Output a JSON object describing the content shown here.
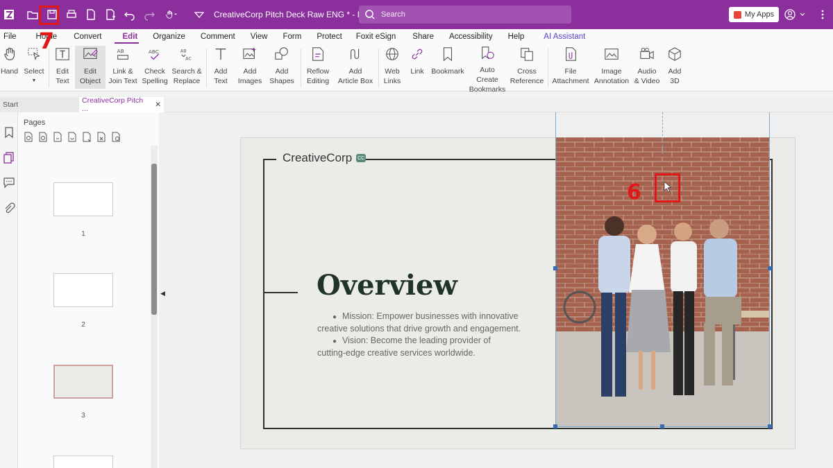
{
  "titlebar": {
    "doc_title": "CreativeCorp Pitch Deck Raw ENG * - Foxit PDF...",
    "search_placeholder": "Search",
    "my_apps": "My Apps"
  },
  "menu": [
    "File",
    "Home",
    "Convert",
    "Edit",
    "Organize",
    "Comment",
    "View",
    "Form",
    "Protect",
    "Foxit eSign",
    "Share",
    "Accessibility",
    "Help",
    "AI Assistant"
  ],
  "ribbon": {
    "hand": "Hand",
    "select": "Select",
    "edit_text": [
      "Edit",
      "Text"
    ],
    "edit_object": [
      "Edit",
      "Object"
    ],
    "link_join": [
      "Link &",
      "Join Text"
    ],
    "check_spelling": [
      "Check",
      "Spelling"
    ],
    "search_replace": [
      "Search &",
      "Replace"
    ],
    "add_text": [
      "Add",
      "Text"
    ],
    "add_images": [
      "Add",
      "Images"
    ],
    "add_shapes": [
      "Add",
      "Shapes"
    ],
    "reflow_editing": [
      "Reflow",
      "Editing"
    ],
    "add_article_box": [
      "Add",
      "Article Box"
    ],
    "web_links": [
      "Web",
      "Links"
    ],
    "link": "Link",
    "bookmark": "Bookmark",
    "auto_create_bookmarks": [
      "Auto Create",
      "Bookmarks"
    ],
    "cross_reference": [
      "Cross",
      "Reference"
    ],
    "file_attachment": [
      "File",
      "Attachment"
    ],
    "image_annotation": [
      "Image",
      "Annotation"
    ],
    "audio_video": [
      "Audio",
      "& Video"
    ],
    "add_3d": [
      "Add",
      "3D"
    ]
  },
  "tabs": {
    "start": "Start",
    "doc": "CreativeCorp Pitch ..."
  },
  "pages_panel": {
    "title": "Pages",
    "thumbnails": [
      "1",
      "2",
      "3"
    ]
  },
  "slide": {
    "brand": "CreativeCorp",
    "brand_logo": "CC",
    "heading": "Overview",
    "bullet1_line1": "Mission: Empower businesses with innovative",
    "bullet1_line2": "creative solutions that drive growth and engagement.",
    "bullet2_line1": "Vision: Become the leading provider of",
    "bullet2_line2": "cutting-edge creative services worldwide."
  },
  "annotations": {
    "step_save": "7",
    "step_image": "6"
  },
  "colors": {
    "accent": "#8a2f9c",
    "annotation": "#e01818",
    "heading": "#1f3326"
  }
}
